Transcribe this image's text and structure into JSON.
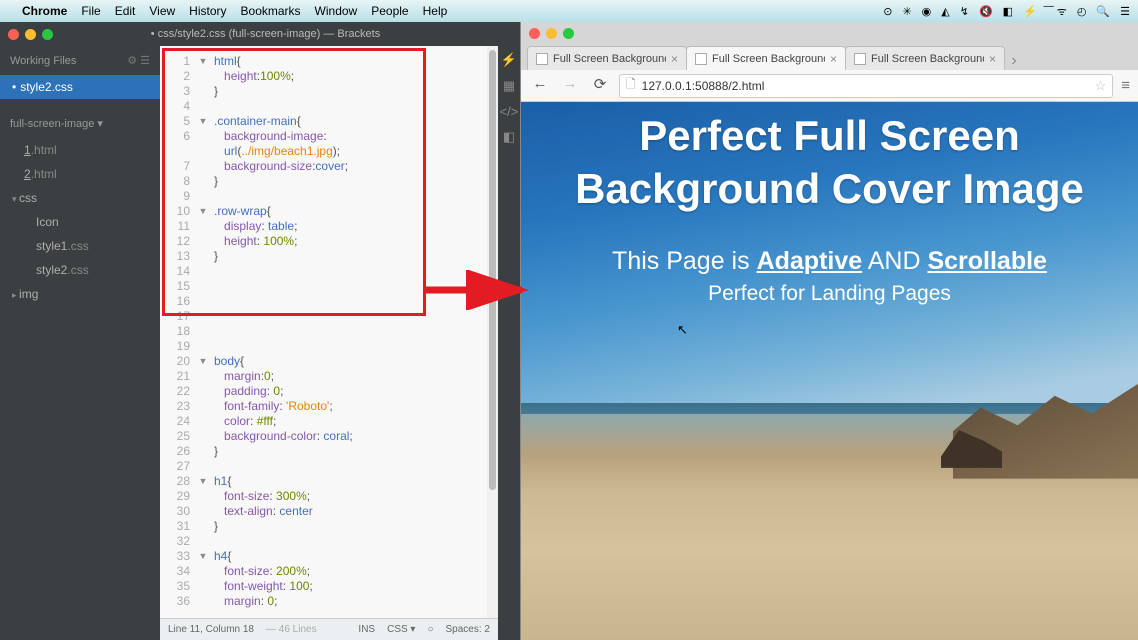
{
  "menubar": {
    "app": "Chrome",
    "items": [
      "File",
      "Edit",
      "View",
      "History",
      "Bookmarks",
      "Window",
      "People",
      "Help"
    ],
    "right_icons": [
      "⊙",
      "✳",
      "◉",
      "◭",
      "↯",
      "🔇",
      "◧",
      "⚡",
      "͞",
      "ᯤ",
      "◴",
      "🔍",
      "☰"
    ]
  },
  "brackets": {
    "title": "• css/style2.css (full-screen-image) — Brackets",
    "working_files": "Working Files",
    "wf_item": "style2.css",
    "project": "full-screen-image",
    "tree": [
      {
        "label": "1.html",
        "type": "file"
      },
      {
        "label": "2.html",
        "type": "file"
      },
      {
        "label": "css",
        "type": "folder",
        "open": true
      },
      {
        "label": "Icon",
        "type": "file",
        "indent": 2
      },
      {
        "label": "style1",
        "ext": ".css",
        "type": "file",
        "indent": 2
      },
      {
        "label": "style2",
        "ext": ".css",
        "type": "file",
        "indent": 2
      },
      {
        "label": "img",
        "type": "folder",
        "open": false
      }
    ],
    "status": {
      "pos": "Line 11, Column 18",
      "lines": "— 46 Lines",
      "ins": "INS",
      "lang": "CSS",
      "spaces": "Spaces: 2"
    },
    "code": [
      {
        "n": 1,
        "f": "▼",
        "t": [
          [
            "sel",
            "html"
          ],
          [
            "punc",
            "{"
          ]
        ]
      },
      {
        "n": 2,
        "t": [
          [
            "ind",
            "   "
          ],
          [
            "prop",
            "height"
          ],
          [
            "punc",
            ":"
          ],
          [
            "num",
            "100%"
          ],
          [
            "punc",
            ";"
          ]
        ]
      },
      {
        "n": 3,
        "t": [
          [
            "punc",
            "}"
          ]
        ]
      },
      {
        "n": 4,
        "t": []
      },
      {
        "n": 5,
        "f": "▼",
        "t": [
          [
            "sel",
            ".container-main"
          ],
          [
            "punc",
            "{"
          ]
        ]
      },
      {
        "n": 6,
        "t": [
          [
            "ind",
            "   "
          ],
          [
            "prop",
            "background-image"
          ],
          [
            "punc",
            ":"
          ]
        ]
      },
      {
        "n": 7,
        "pre": "   ",
        "t": [
          [
            "val",
            "url"
          ],
          [
            "punc",
            "("
          ],
          [
            "str",
            "../img/beach1.jpg"
          ],
          [
            "punc",
            ")"
          ],
          [
            "punc",
            ";"
          ]
        ]
      },
      {
        "n": 7,
        "real": 7,
        "t": [
          [
            "ind",
            "   "
          ],
          [
            "prop",
            "background-size"
          ],
          [
            "punc",
            ":"
          ],
          [
            "val",
            "cover"
          ],
          [
            "punc",
            ";"
          ]
        ]
      },
      {
        "n": 8,
        "t": [
          [
            "punc",
            "}"
          ]
        ]
      },
      {
        "n": 9,
        "t": []
      },
      {
        "n": 10,
        "f": "▼",
        "t": [
          [
            "sel",
            ".row-wrap"
          ],
          [
            "punc",
            "{"
          ]
        ]
      },
      {
        "n": 11,
        "t": [
          [
            "ind",
            "   "
          ],
          [
            "prop",
            "display"
          ],
          [
            "punc",
            ": "
          ],
          [
            "val",
            "table"
          ],
          [
            "punc",
            ";"
          ]
        ]
      },
      {
        "n": 12,
        "t": [
          [
            "ind",
            "   "
          ],
          [
            "prop",
            "height"
          ],
          [
            "punc",
            ": "
          ],
          [
            "num",
            "100%"
          ],
          [
            "punc",
            ";"
          ]
        ]
      },
      {
        "n": 13,
        "t": [
          [
            "punc",
            "}"
          ]
        ]
      },
      {
        "n": 14,
        "t": []
      },
      {
        "n": 15,
        "t": []
      },
      {
        "n": 16,
        "t": []
      },
      {
        "n": 17,
        "t": []
      },
      {
        "n": 18,
        "t": []
      },
      {
        "n": 19,
        "t": []
      },
      {
        "n": 20,
        "f": "▼",
        "t": [
          [
            "sel",
            "body"
          ],
          [
            "punc",
            "{"
          ]
        ]
      },
      {
        "n": 21,
        "t": [
          [
            "ind",
            "   "
          ],
          [
            "prop",
            "margin"
          ],
          [
            "punc",
            ":"
          ],
          [
            "num",
            "0"
          ],
          [
            "punc",
            ";"
          ]
        ]
      },
      {
        "n": 22,
        "t": [
          [
            "ind",
            "   "
          ],
          [
            "prop",
            "padding"
          ],
          [
            "punc",
            ": "
          ],
          [
            "num",
            "0"
          ],
          [
            "punc",
            ";"
          ]
        ]
      },
      {
        "n": 23,
        "t": [
          [
            "ind",
            "   "
          ],
          [
            "prop",
            "font-family"
          ],
          [
            "punc",
            ": "
          ],
          [
            "str",
            "'Roboto'"
          ],
          [
            "punc",
            ";"
          ]
        ]
      },
      {
        "n": 24,
        "t": [
          [
            "ind",
            "   "
          ],
          [
            "prop",
            "color"
          ],
          [
            "punc",
            ": "
          ],
          [
            "num",
            "#fff"
          ],
          [
            "punc",
            ";"
          ]
        ]
      },
      {
        "n": 25,
        "t": [
          [
            "ind",
            "   "
          ],
          [
            "prop",
            "background-color"
          ],
          [
            "punc",
            ": "
          ],
          [
            "val",
            "coral"
          ],
          [
            "punc",
            ";"
          ]
        ]
      },
      {
        "n": 26,
        "t": [
          [
            "punc",
            "}"
          ]
        ]
      },
      {
        "n": 27,
        "t": []
      },
      {
        "n": 28,
        "f": "▼",
        "t": [
          [
            "sel",
            "h1"
          ],
          [
            "punc",
            "{"
          ]
        ]
      },
      {
        "n": 29,
        "t": [
          [
            "ind",
            "   "
          ],
          [
            "prop",
            "font-size"
          ],
          [
            "punc",
            ": "
          ],
          [
            "num",
            "300%"
          ],
          [
            "punc",
            ";"
          ]
        ]
      },
      {
        "n": 30,
        "t": [
          [
            "ind",
            "   "
          ],
          [
            "prop",
            "text-align"
          ],
          [
            "punc",
            ": "
          ],
          [
            "val",
            "center"
          ]
        ]
      },
      {
        "n": 31,
        "t": [
          [
            "punc",
            "}"
          ]
        ]
      },
      {
        "n": 32,
        "t": []
      },
      {
        "n": 33,
        "f": "▼",
        "t": [
          [
            "sel",
            "h4"
          ],
          [
            "punc",
            "{"
          ]
        ]
      },
      {
        "n": 34,
        "t": [
          [
            "ind",
            "   "
          ],
          [
            "prop",
            "font-size"
          ],
          [
            "punc",
            ": "
          ],
          [
            "num",
            "200%"
          ],
          [
            "punc",
            ";"
          ]
        ]
      },
      {
        "n": 35,
        "t": [
          [
            "ind",
            "   "
          ],
          [
            "prop",
            "font-weight"
          ],
          [
            "punc",
            ": "
          ],
          [
            "num",
            "100"
          ],
          [
            "punc",
            ";"
          ]
        ]
      },
      {
        "n": 36,
        "t": [
          [
            "ind",
            "   "
          ],
          [
            "prop",
            "margin"
          ],
          [
            "punc",
            ": "
          ],
          [
            "num",
            "0"
          ],
          [
            "punc",
            ";"
          ]
        ]
      }
    ]
  },
  "chrome": {
    "tabs": [
      {
        "label": "Full Screen Background",
        "active": false
      },
      {
        "label": "Full Screen Background",
        "active": true
      },
      {
        "label": "Full Screen Background",
        "active": false
      }
    ],
    "url": "127.0.0.1:50888/2.html",
    "page": {
      "h1_l1": "Perfect Full Screen",
      "h1_l2": "Background Cover Image",
      "h4_pre": "This Page is ",
      "h4_u1": "Adaptive",
      "h4_mid": " AND ",
      "h4_u2": "Scrollable",
      "sub": "Perfect for Landing Pages"
    }
  }
}
